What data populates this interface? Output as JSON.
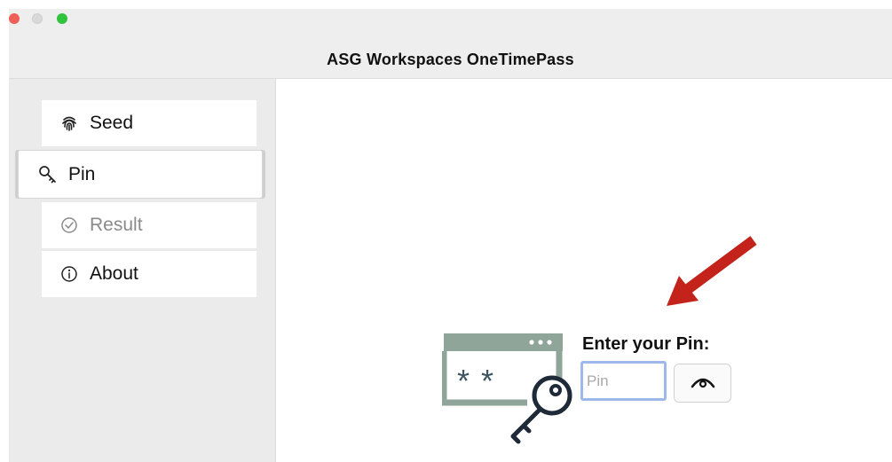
{
  "window": {
    "title": "ASG Workspaces OneTimePass"
  },
  "sidebar": {
    "items": [
      {
        "label": "Seed",
        "icon": "fingerprint-icon",
        "state": "normal"
      },
      {
        "label": "Pin",
        "icon": "key-icon",
        "state": "selected"
      },
      {
        "label": "Result",
        "icon": "check-circle-icon",
        "state": "disabled"
      },
      {
        "label": "About",
        "icon": "info-icon",
        "state": "normal"
      }
    ]
  },
  "pin_form": {
    "label": "Enter your Pin:",
    "input_value": "",
    "input_placeholder": "Pin",
    "reveal_icon": "eye-icon"
  },
  "colors": {
    "illustration": "#8fa59a",
    "arrow": "#c4231b",
    "input_focus": "#9fb8ea"
  }
}
